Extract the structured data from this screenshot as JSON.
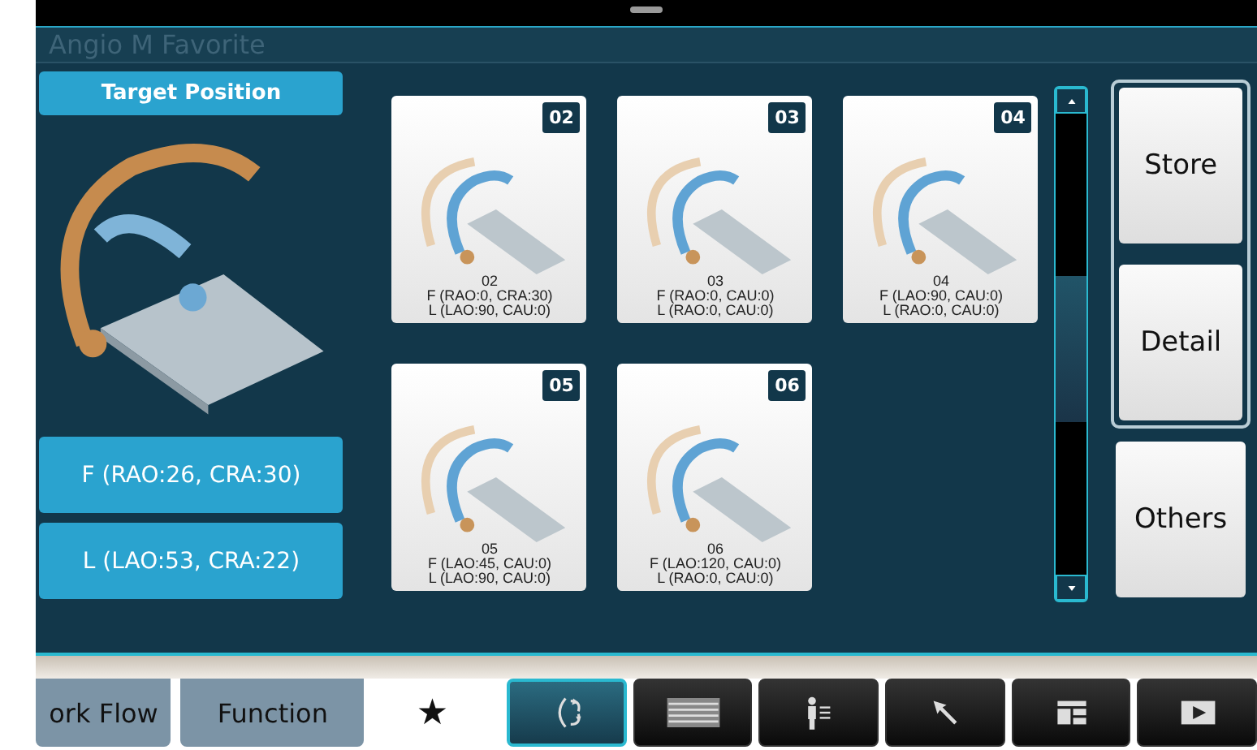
{
  "window": {
    "title": "Angio M Favorite"
  },
  "target": {
    "label": "Target Position"
  },
  "positions": [
    {
      "label": "F (RAO:26, CRA:30)"
    },
    {
      "label": "L (LAO:53, CRA:22)"
    }
  ],
  "cards": [
    {
      "badge": "02",
      "number": "02",
      "f": "F (RAO:0, CRA:30)",
      "l": "L (LAO:90, CAU:0)"
    },
    {
      "badge": "03",
      "number": "03",
      "f": "F (RAO:0, CAU:0)",
      "l": "L (RAO:0, CAU:0)"
    },
    {
      "badge": "04",
      "number": "04",
      "f": "F (LAO:90, CAU:0)",
      "l": "L (RAO:0, CAU:0)"
    },
    {
      "badge": "05",
      "number": "05",
      "f": "F (LAO:45, CAU:0)",
      "l": "L (LAO:90, CAU:0)"
    },
    {
      "badge": "06",
      "number": "06",
      "f": "F (LAO:120, CAU:0)",
      "l": "L (RAO:0, CAU:0)"
    }
  ],
  "action_group": [
    {
      "label": "Store"
    },
    {
      "label": "Detail"
    }
  ],
  "actions": [
    {
      "label": "Others"
    }
  ],
  "tabs": [
    {
      "label": "ork Flow",
      "selected": false
    },
    {
      "label": "Function",
      "selected": false
    },
    {
      "label": "★",
      "selected": true
    }
  ],
  "toolbar": [
    {
      "kind": "rotate",
      "selected": true
    },
    {
      "kind": "list",
      "selected": false
    },
    {
      "kind": "person",
      "selected": false
    },
    {
      "kind": "pointer",
      "selected": false
    },
    {
      "kind": "layout",
      "selected": false
    },
    {
      "kind": "play",
      "selected": false
    }
  ]
}
